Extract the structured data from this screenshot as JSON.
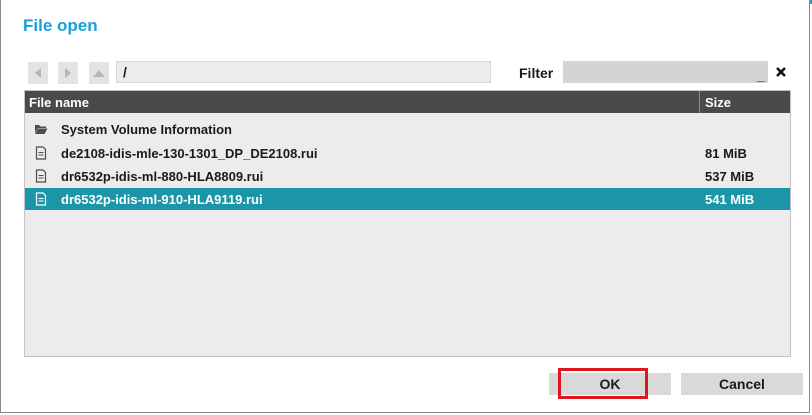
{
  "dialog": {
    "title": "File open"
  },
  "nav": {
    "back_icon": "chevron-left-icon",
    "forward_icon": "chevron-right-icon",
    "up_icon": "up-arrow-icon",
    "path": "/"
  },
  "filter": {
    "label": "Filter",
    "value": "",
    "caret": "_",
    "clear_icon": "close-icon"
  },
  "file_list": {
    "columns": [
      "File name",
      "Size"
    ],
    "rows": [
      {
        "type": "folder",
        "name": "System Volume Information",
        "size": ""
      },
      {
        "type": "file",
        "name": "de2108-idis-mle-130-1301_DP_DE2108.rui",
        "size": "81 MiB"
      },
      {
        "type": "file",
        "name": "dr6532p-idis-ml-880-HLA8809.rui",
        "size": "537 MiB"
      },
      {
        "type": "file",
        "name": "dr6532p-idis-ml-910-HLA9119.rui",
        "size": "541 MiB",
        "selected": true
      }
    ],
    "selected_color": "#1b95a8"
  },
  "buttons": {
    "ok_label": "OK",
    "cancel_label": "Cancel"
  },
  "colors": {
    "accent": "#2c9fb0",
    "title": "#1a9fd6",
    "highlight": "#e0151d",
    "header_bg": "#4a4a4a"
  }
}
